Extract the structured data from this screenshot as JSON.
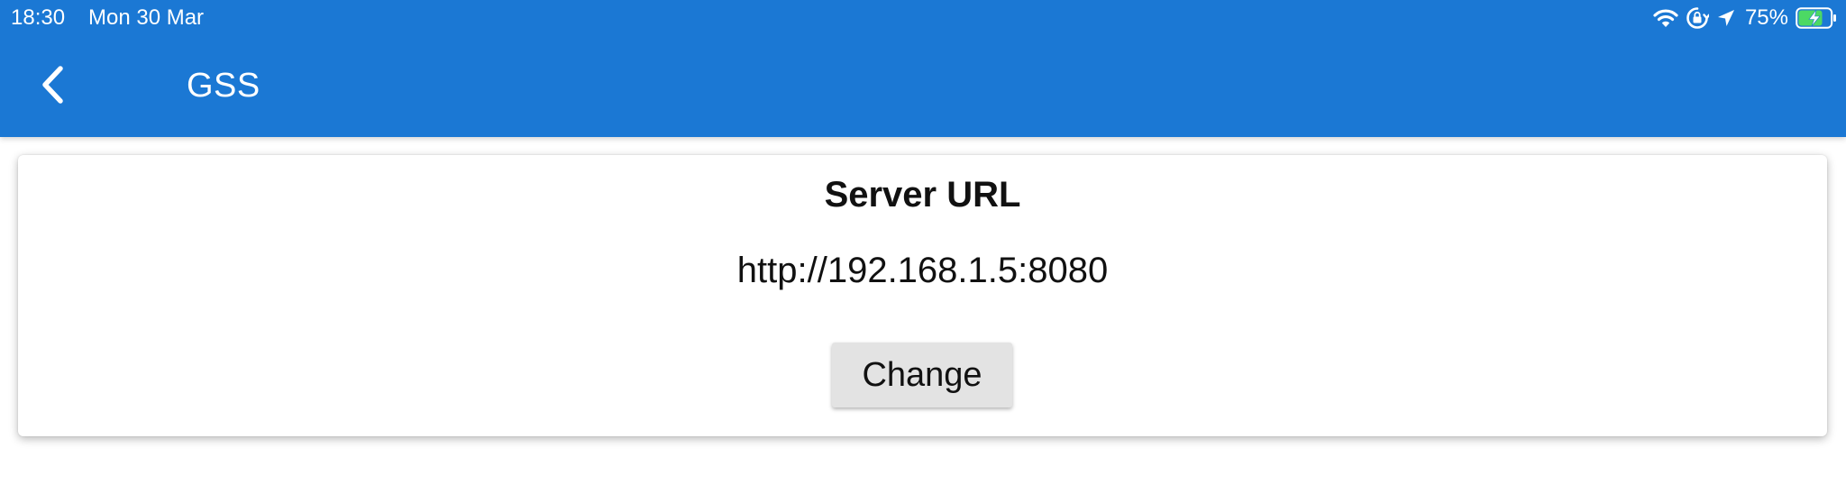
{
  "status_bar": {
    "time": "18:30",
    "date": "Mon 30 Mar",
    "battery_percent": "75%",
    "icons": [
      "wifi-icon",
      "orientation-lock-icon",
      "location-arrow-icon",
      "battery-charging-icon"
    ],
    "battery_color": "#4cd964"
  },
  "app_bar": {
    "back_icon": "chevron-left-icon",
    "title": "GSS",
    "color": "#1b78d4"
  },
  "card": {
    "title": "Server URL",
    "server_url": "http://192.168.1.5:8080",
    "change_label": "Change"
  }
}
